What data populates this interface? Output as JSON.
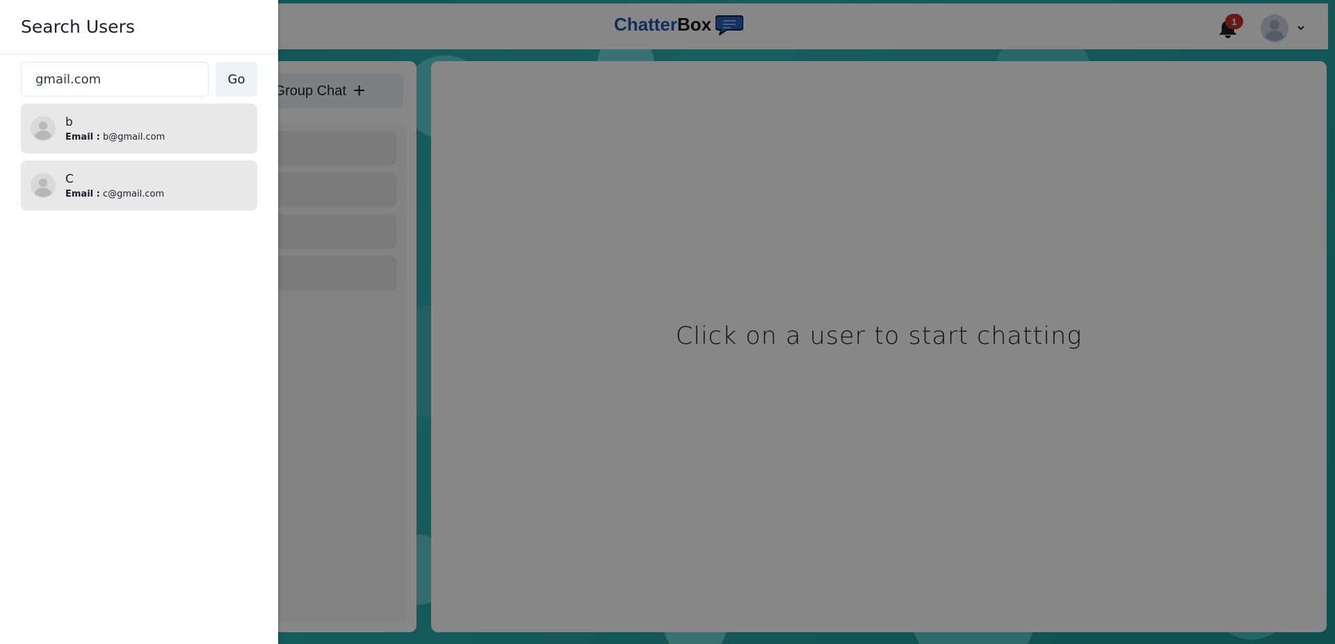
{
  "header": {
    "brand_part1": "Chatter",
    "brand_part2": "Box",
    "notification_count": "1",
    "brand_color": "#1e5aa8"
  },
  "chats": {
    "group_chat_label": "Group Chat",
    "group_chat_icon": "plus-icon",
    "placeholder_rows": 4
  },
  "chatbox": {
    "empty_message": "Click on a user to start chatting"
  },
  "drawer": {
    "title": "Search Users",
    "search_value": "gmail.com",
    "go_label": "Go",
    "email_label": "Email :",
    "results": [
      {
        "name": "b",
        "email": "b@gmail.com"
      },
      {
        "name": "C",
        "email": "c@gmail.com"
      }
    ]
  },
  "colors": {
    "overlay": "rgba(0,0,0,0.47)",
    "badge": "#c53030",
    "background_teal": "#2ba6a8"
  }
}
